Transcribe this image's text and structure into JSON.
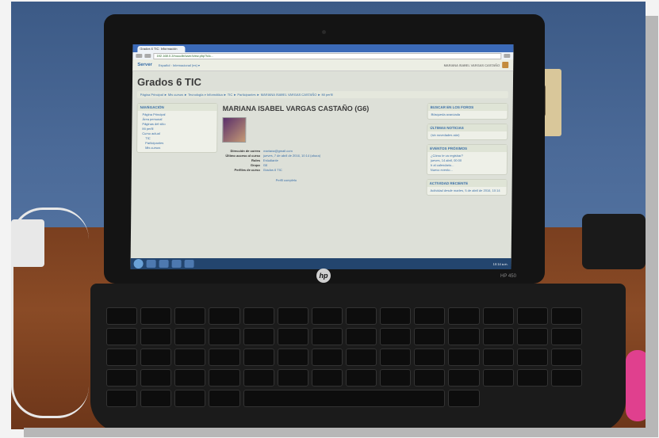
{
  "laptop": {
    "brand": "hp",
    "model": "HP 450"
  },
  "browser": {
    "tab_title": "Grados 6 TIC: Información",
    "url": "192.168.0.2/moodle/user/view.php?id=..."
  },
  "site": {
    "name": "Server",
    "language": "Español - Internacional (es) ▾",
    "user_login": "MARIANA ISABEL VARGAS CASTAÑO",
    "course_title": "Grados 6 TIC",
    "breadcrumb": "Página Principal ► Mis cursos ► Tecnología e Informática ► TIC ► Participantes ► MARIANA ISABEL VARGAS CASTAÑO ► Mi perfil"
  },
  "navigation": {
    "title": "NAVEGACIÓN",
    "items": [
      "Página Principal",
      "Área personal",
      "Páginas del sitio",
      "Mi perfil",
      "Curso actual",
      "TIC",
      "Participantes",
      "Mis cursos"
    ]
  },
  "profile": {
    "name": "MARIANA ISABEL VARGAS CASTAÑO (G6)",
    "fields": [
      {
        "label": "Dirección de correo",
        "value": "mariana@gmail.com"
      },
      {
        "label": "Último acceso al curso",
        "value": "jueves, 7 de abril de 2016, 10:14 (ahora)"
      },
      {
        "label": "Roles",
        "value": "Estudiante"
      },
      {
        "label": "Grupo",
        "value": "G6"
      },
      {
        "label": "Perfiles de curso",
        "value": "Grados 6 TIC"
      }
    ],
    "full_profile_link": "Perfil completo"
  },
  "right_blocks": [
    {
      "title": "BUSCAR EN LOS FOROS",
      "body": [
        "Búsqueda avanzada"
      ]
    },
    {
      "title": "ÚLTIMAS NOTICIAS",
      "body": [
        "(sin novedades aún)"
      ]
    },
    {
      "title": "EVENTOS PRÓXIMOS",
      "body": [
        "¿Cómo te va registrar?",
        "jueves, 14 abril, 00:00",
        "Ir al calendario...",
        "Nuevo evento..."
      ]
    },
    {
      "title": "ACTIVIDAD RECIENTE",
      "body": [
        "Actividad desde martes, 5 de abril de 2016, 10:14"
      ]
    }
  ],
  "taskbar": {
    "clock": "10:14 a.m."
  }
}
